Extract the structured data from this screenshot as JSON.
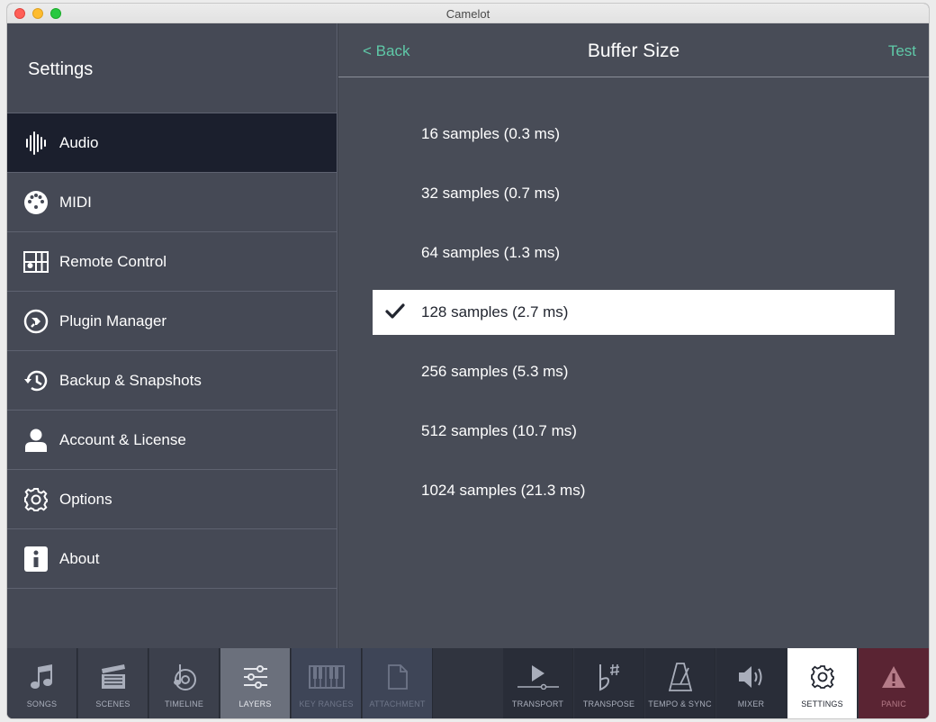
{
  "window": {
    "title": "Camelot"
  },
  "sidebar": {
    "title": "Settings",
    "items": [
      {
        "label": "Audio",
        "icon": "audio-waveform-icon",
        "active": true
      },
      {
        "label": "MIDI",
        "icon": "midi-connector-icon",
        "active": false
      },
      {
        "label": "Remote Control",
        "icon": "remote-control-icon",
        "active": false
      },
      {
        "label": "Plugin Manager",
        "icon": "plugin-icon",
        "active": false
      },
      {
        "label": "Backup & Snapshots",
        "icon": "history-icon",
        "active": false
      },
      {
        "label": "Account & License",
        "icon": "user-icon",
        "active": false
      },
      {
        "label": "Options",
        "icon": "gear-icon",
        "active": false
      },
      {
        "label": "About",
        "icon": "info-icon",
        "active": false
      }
    ]
  },
  "main": {
    "back_label": "< Back",
    "title": "Buffer Size",
    "test_label": "Test",
    "options": [
      {
        "label": "16 samples (0.3 ms)",
        "selected": false
      },
      {
        "label": "32 samples (0.7 ms)",
        "selected": false
      },
      {
        "label": "64 samples (1.3 ms)",
        "selected": false
      },
      {
        "label": "128 samples (2.7 ms)",
        "selected": true
      },
      {
        "label": "256 samples (5.3 ms)",
        "selected": false
      },
      {
        "label": "512 samples (10.7 ms)",
        "selected": false
      },
      {
        "label": "1024 samples (21.3 ms)",
        "selected": false
      }
    ]
  },
  "toolbar": {
    "items": [
      {
        "label": "SONGS",
        "icon": "music-note-icon"
      },
      {
        "label": "SCENES",
        "icon": "clapperboard-icon"
      },
      {
        "label": "TIMELINE",
        "icon": "timeline-icon"
      },
      {
        "label": "LAYERS",
        "icon": "sliders-icon"
      },
      {
        "label": "KEY RANGES",
        "icon": "keyboard-icon"
      },
      {
        "label": "ATTACHMENT",
        "icon": "document-icon"
      },
      {
        "label": "TRANSPORT",
        "icon": "play-icon"
      },
      {
        "label": "TRANSPOSE",
        "icon": "flat-sharp-icon"
      },
      {
        "label": "TEMPO & SYNC",
        "icon": "metronome-icon"
      },
      {
        "label": "MIXER",
        "icon": "speaker-icon"
      },
      {
        "label": "SETTINGS",
        "icon": "gear-icon"
      },
      {
        "label": "PANIC",
        "icon": "warning-icon"
      }
    ]
  },
  "colors": {
    "accent": "#5fc9a8",
    "sidebar_active": "#1b1f2d",
    "panic": "#5a2433"
  }
}
